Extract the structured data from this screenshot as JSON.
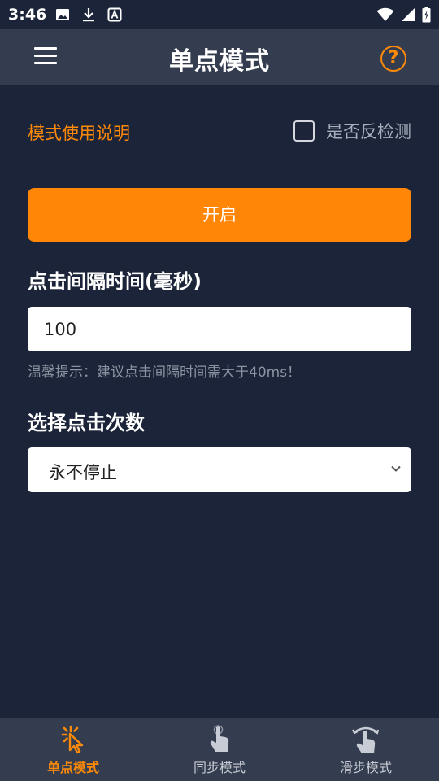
{
  "status_bar": {
    "time": "3:46"
  },
  "header": {
    "title": "单点模式",
    "help_glyph": "?"
  },
  "options": {
    "guide_link": "模式使用说明",
    "reverse_detect_label": "是否反检测",
    "reverse_detect_checked": false
  },
  "start_button": {
    "label": "开启"
  },
  "interval": {
    "label": "点击间隔时间(毫秒)",
    "value": "100",
    "hint": "温馨提示：建议点击间隔时间需大于40ms！"
  },
  "click_count": {
    "label": "选择点击次数",
    "selected": "永不停止"
  },
  "bottom_nav": {
    "items": [
      {
        "label": "单点模式",
        "icon": "tap-burst-icon",
        "active": true
      },
      {
        "label": "同步模式",
        "icon": "hand-pointer-icon",
        "active": false
      },
      {
        "label": "滑步模式",
        "icon": "swipe-hand-icon",
        "active": false
      }
    ]
  },
  "colors": {
    "accent": "#ff8606",
    "background": "#1b2438",
    "bar": "#343d4f"
  }
}
